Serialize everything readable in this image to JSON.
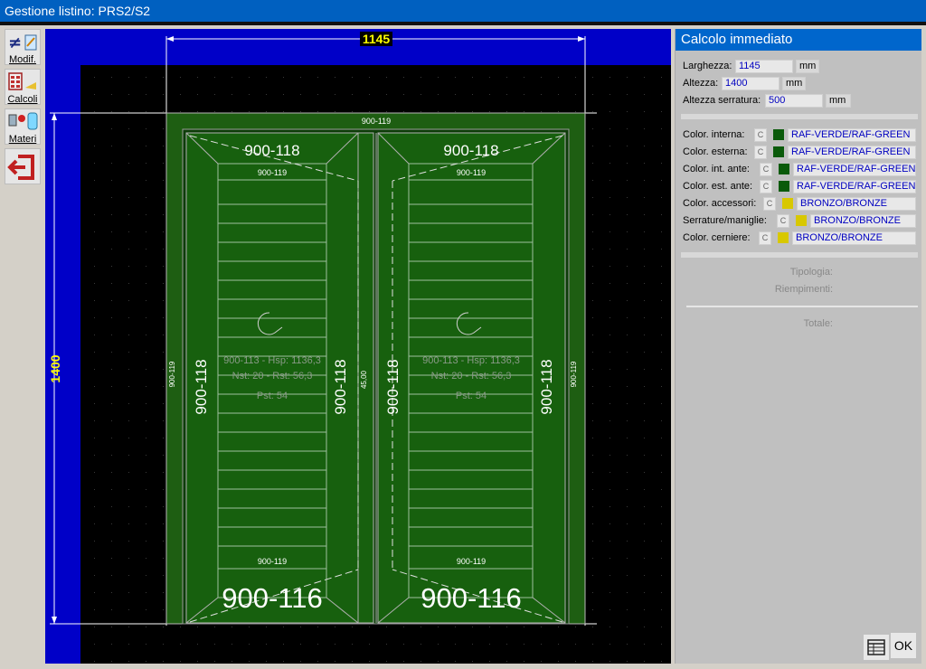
{
  "window": {
    "title": "Gestione listino: PRS2/S2"
  },
  "toolbar": {
    "modify_label": "Modif.",
    "calc_label": "Calcoli",
    "materials_label": "Materi"
  },
  "drawing": {
    "width_dim": "1145",
    "height_dim": "1400",
    "frame_top": "900-119",
    "frame_left": "900-119",
    "frame_right": "900-119",
    "center_dim": "45,00",
    "left_leaf": {
      "top": "900-118",
      "inner_top": "900-119",
      "left": "900-118",
      "right": "900-118",
      "bottom": "900-116",
      "inner_bottom": "900-119",
      "info1": "900-113 - Hsp: 1136,3",
      "info2": "Nst: 20 - Rst: 56,3",
      "info3": "Pst: 54"
    },
    "right_leaf": {
      "top": "900-118",
      "inner_top": "900-119",
      "left": "900-118",
      "right": "900-118",
      "bottom": "900-116",
      "inner_bottom": "900-119",
      "info1": "900-113 - Hsp: 1136,3",
      "info2": "Nst: 20 - Rst: 56,3",
      "info3": "Pst: 54"
    },
    "colors": {
      "frame": "#1e5e12",
      "leaf": "#17600e",
      "bg_blue": "#0000c8",
      "bg_black": "#000000",
      "dim_yellow": "#ffff00"
    }
  },
  "panel": {
    "title": "Calcolo immediato",
    "width_label": "Larghezza:",
    "width_value": "1145",
    "width_unit": "mm",
    "height_label": "Altezza:",
    "height_value": "1400",
    "height_unit": "mm",
    "lock_height_label": "Altezza serratura:",
    "lock_height_value": "500",
    "lock_height_unit": "mm",
    "colors": [
      {
        "label": "Color. interna:",
        "c": "C",
        "swatch": "#0a5a0a",
        "value": "RAF-VERDE/RAF-GREEN"
      },
      {
        "label": "Color. esterna:",
        "c": "C",
        "swatch": "#0a5a0a",
        "value": "RAF-VERDE/RAF-GREEN"
      },
      {
        "label": "Color. int. ante:",
        "c": "C",
        "swatch": "#0a5a0a",
        "value": "RAF-VERDE/RAF-GREEN"
      },
      {
        "label": "Color. est. ante:",
        "c": "C",
        "swatch": "#0a5a0a",
        "value": "RAF-VERDE/RAF-GREEN"
      },
      {
        "label": "Color. accessori:",
        "c": "C",
        "swatch": "#d8c800",
        "value": "BRONZO/BRONZE"
      },
      {
        "label": "Serrature/maniglie:",
        "c": "C",
        "swatch": "#d8c800",
        "value": "BRONZO/BRONZE"
      },
      {
        "label": "Color. cerniere:",
        "c": "C",
        "swatch": "#d8c800",
        "value": "BRONZO/BRONZE"
      }
    ],
    "typology_label": "Tipologia:",
    "fillings_label": "Riempimenti:",
    "total_label": "Totale:",
    "ok_label": "OK"
  }
}
